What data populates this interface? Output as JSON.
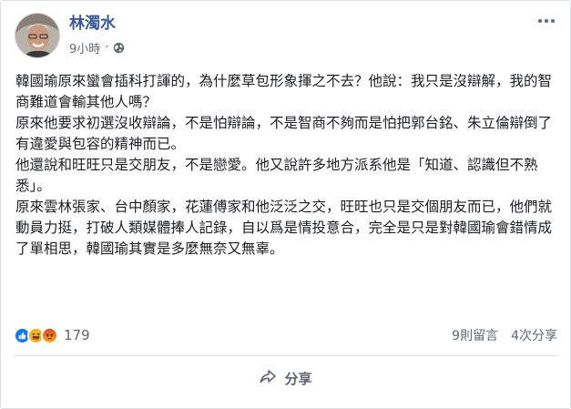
{
  "post": {
    "author": "林濁水",
    "time": "9小時",
    "privacy_icon": "globe-icon",
    "paragraphs": [
      "韓國瑜原來蠻會插科打諢的，為什麼草包形象揮之不去？他說：我只是沒辯解，我的智商難道會輸其他人嗎？",
      "原來他要求初選沒收辯論，不是怕辯論，不是智商不夠而是怕把郭台銘、朱立倫辯倒了有違愛與包容的精神而已。",
      "他還說和旺旺只是交朋友，不是戀愛。他又說許多地方派系他是「知道、認識但不熟悉」。",
      "原來雲林張家、台中顏家，花蓮傅家和他泛泛之交，旺旺也只是交個朋友而已，他們就動員力挺，打破人類媒體捧人記錄，自以爲是情投意合，完全是只是對韓國瑜會錯情成了單相思，韓國瑜其實是多麼無奈又無辜。"
    ]
  },
  "stats": {
    "reaction_icons": [
      "like-icon",
      "haha-icon",
      "angry-icon"
    ],
    "reaction_count": "179",
    "comments": "9則留言",
    "shares": "4次分享"
  },
  "actions": {
    "share_label": "分享",
    "share_icon": "share-arrow-icon"
  },
  "colors": {
    "author_link": "#385898",
    "like_blue": "#1877f2",
    "haha_yellow": "#f7b125",
    "angry_orange": "#e9710f",
    "secondary_text": "#606770"
  }
}
